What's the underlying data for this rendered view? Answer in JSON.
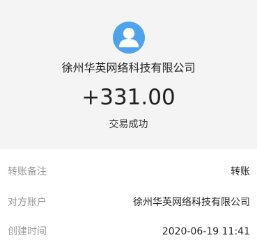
{
  "header": {
    "avatar_icon": "user-avatar-icon",
    "avatar_color": "#4fa3ee",
    "company": "徐州华英网络科技有限公司",
    "amount": "+331.00",
    "status": "交易成功"
  },
  "details": [
    {
      "label": "转账备注",
      "value": "转账"
    },
    {
      "label": "对方账户",
      "value": "徐州华英网络科技有限公司"
    },
    {
      "label": "创建时间",
      "value": "2020-06-19 11:41"
    }
  ]
}
